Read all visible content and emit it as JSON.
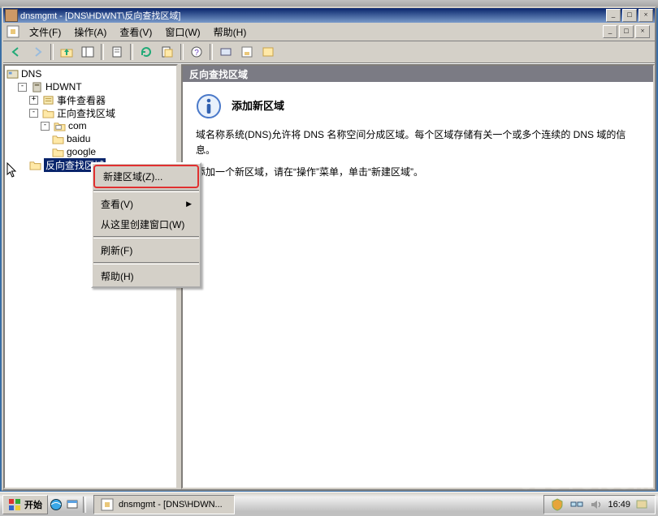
{
  "window": {
    "title": "dnsmgmt - [DNS\\HDWNT\\反向查找区域]",
    "min": "_",
    "max": "□",
    "close": "×"
  },
  "menubar": {
    "file": "文件(F)",
    "action": "操作(A)",
    "view": "查看(V)",
    "window": "窗口(W)",
    "help": "帮助(H)"
  },
  "tree": {
    "root": "DNS",
    "server": "HDWNT",
    "event_viewer": "事件查看器",
    "fwd_zone": "正向查找区域",
    "com": "com",
    "baidu": "baidu",
    "google": "google",
    "rev_zone": "反向查找区域"
  },
  "content": {
    "header": "反向查找区域",
    "info_title": "添加新区域",
    "info_line1": "域名称系统(DNS)允许将 DNS 名称空间分成区域。每个区域存储有关一个或多个连续的 DNS 域的信息。",
    "info_line2": "添加一个新区域，请在“操作”菜单，单击“新建区域”。"
  },
  "ctx_menu": {
    "new_zone": "新建区域(Z)...",
    "view": "查看(V)",
    "new_window": "从这里创建窗口(W)",
    "refresh": "刷新(F)",
    "help": "帮助(H)"
  },
  "taskbar": {
    "start": "开始",
    "task_entry": "dnsmgmt - [DNS\\HDWN...",
    "clock": "16:49"
  },
  "colors": {
    "titlebar": "#08246b",
    "panel": "#d4d0c8"
  },
  "icons": {
    "app": "mmc-icon",
    "dns": "dns-root-icon",
    "server": "server-icon",
    "folder": "folder-icon",
    "folder_open": "folder-open-icon",
    "zone": "zone-icon",
    "info": "info-icon"
  }
}
